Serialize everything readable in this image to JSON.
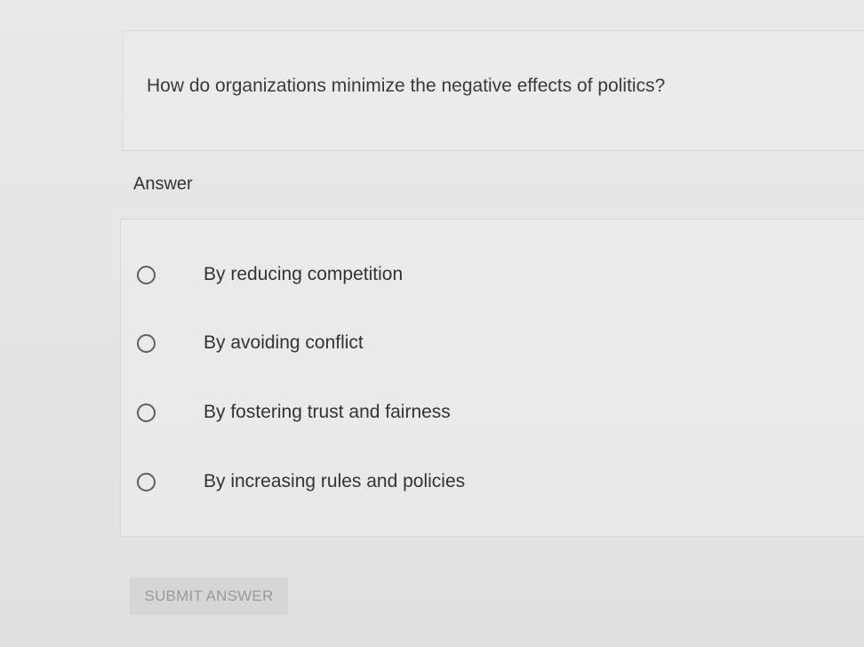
{
  "question": {
    "text": "How do organizations minimize the negative effects of politics?"
  },
  "answer": {
    "label": "Answer",
    "options": [
      {
        "label": "By reducing competition",
        "selected": false
      },
      {
        "label": "By avoiding conflict",
        "selected": false
      },
      {
        "label": "By fostering trust and fairness",
        "selected": false
      },
      {
        "label": "By increasing rules and policies",
        "selected": false
      }
    ]
  },
  "submit": {
    "label": "SUBMIT ANSWER",
    "disabled": true
  },
  "colors": {
    "background": "#e6e6e6",
    "text": "#333333",
    "button_background": "#d6d6d6",
    "button_text": "#9a9a9a"
  }
}
